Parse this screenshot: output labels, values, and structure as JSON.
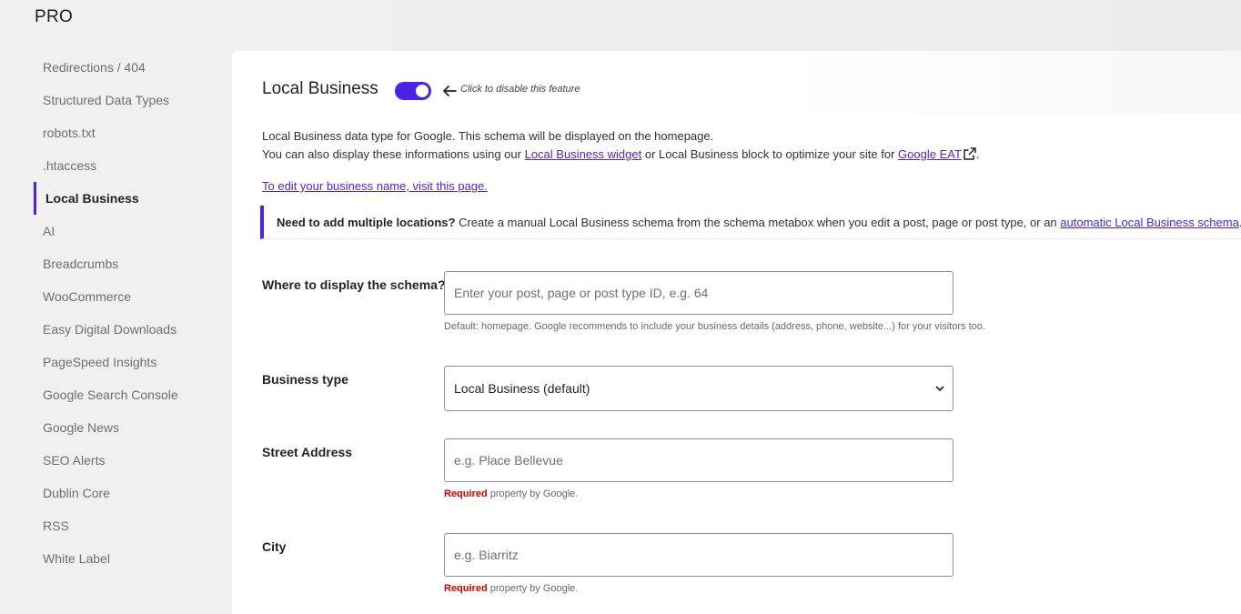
{
  "brand": {
    "label": "PRO"
  },
  "sidebar": {
    "items": [
      {
        "label": "Redirections / 404"
      },
      {
        "label": "Structured Data Types"
      },
      {
        "label": "robots.txt"
      },
      {
        "label": ".htaccess"
      },
      {
        "label": "Local Business",
        "active": true
      },
      {
        "label": "AI"
      },
      {
        "label": "Breadcrumbs"
      },
      {
        "label": "WooCommerce"
      },
      {
        "label": "Easy Digital Downloads"
      },
      {
        "label": "PageSpeed Insights"
      },
      {
        "label": "Google Search Console"
      },
      {
        "label": "Google News"
      },
      {
        "label": "SEO Alerts"
      },
      {
        "label": "Dublin Core"
      },
      {
        "label": "RSS"
      },
      {
        "label": "White Label"
      }
    ]
  },
  "header": {
    "title": "Local Business",
    "toggle_on": true,
    "hint": "Click to disable this feature"
  },
  "description": {
    "line1": "Local Business data type for Google. This schema will be displayed on the homepage.",
    "line2_prefix": "You can also display these informations using our ",
    "widget_link": "Local Business widget",
    "line2_middle": " or Local Business block to optimize your site for ",
    "eat_link": "Google EAT",
    "line2_suffix": ".",
    "edit_link": "To edit your business name, visit this page."
  },
  "notice": {
    "bold": "Need to add multiple locations?",
    "text": " Create a manual Local Business schema from the schema metabox when you edit a post, page or post type, or an ",
    "link": "automatic Local Business schema",
    "suffix": "."
  },
  "fields": {
    "display": {
      "label": "Where to display the schema?",
      "placeholder": "Enter your post, page or post type ID, e.g. 64",
      "help": "Default: homepage. Google recommends to include your business details (address, phone, website...) for your visitors too."
    },
    "business_type": {
      "label": "Business type",
      "selected": "Local Business (default)"
    },
    "street": {
      "label": "Street Address",
      "placeholder": "e.g. Place Bellevue",
      "required": "Required",
      "required_suffix": " property by Google."
    },
    "city": {
      "label": "City",
      "placeholder": "e.g. Biarritz",
      "required": "Required",
      "required_suffix": " property by Google."
    }
  },
  "colors": {
    "accent": "#4e21e7",
    "required": "#d50000"
  }
}
